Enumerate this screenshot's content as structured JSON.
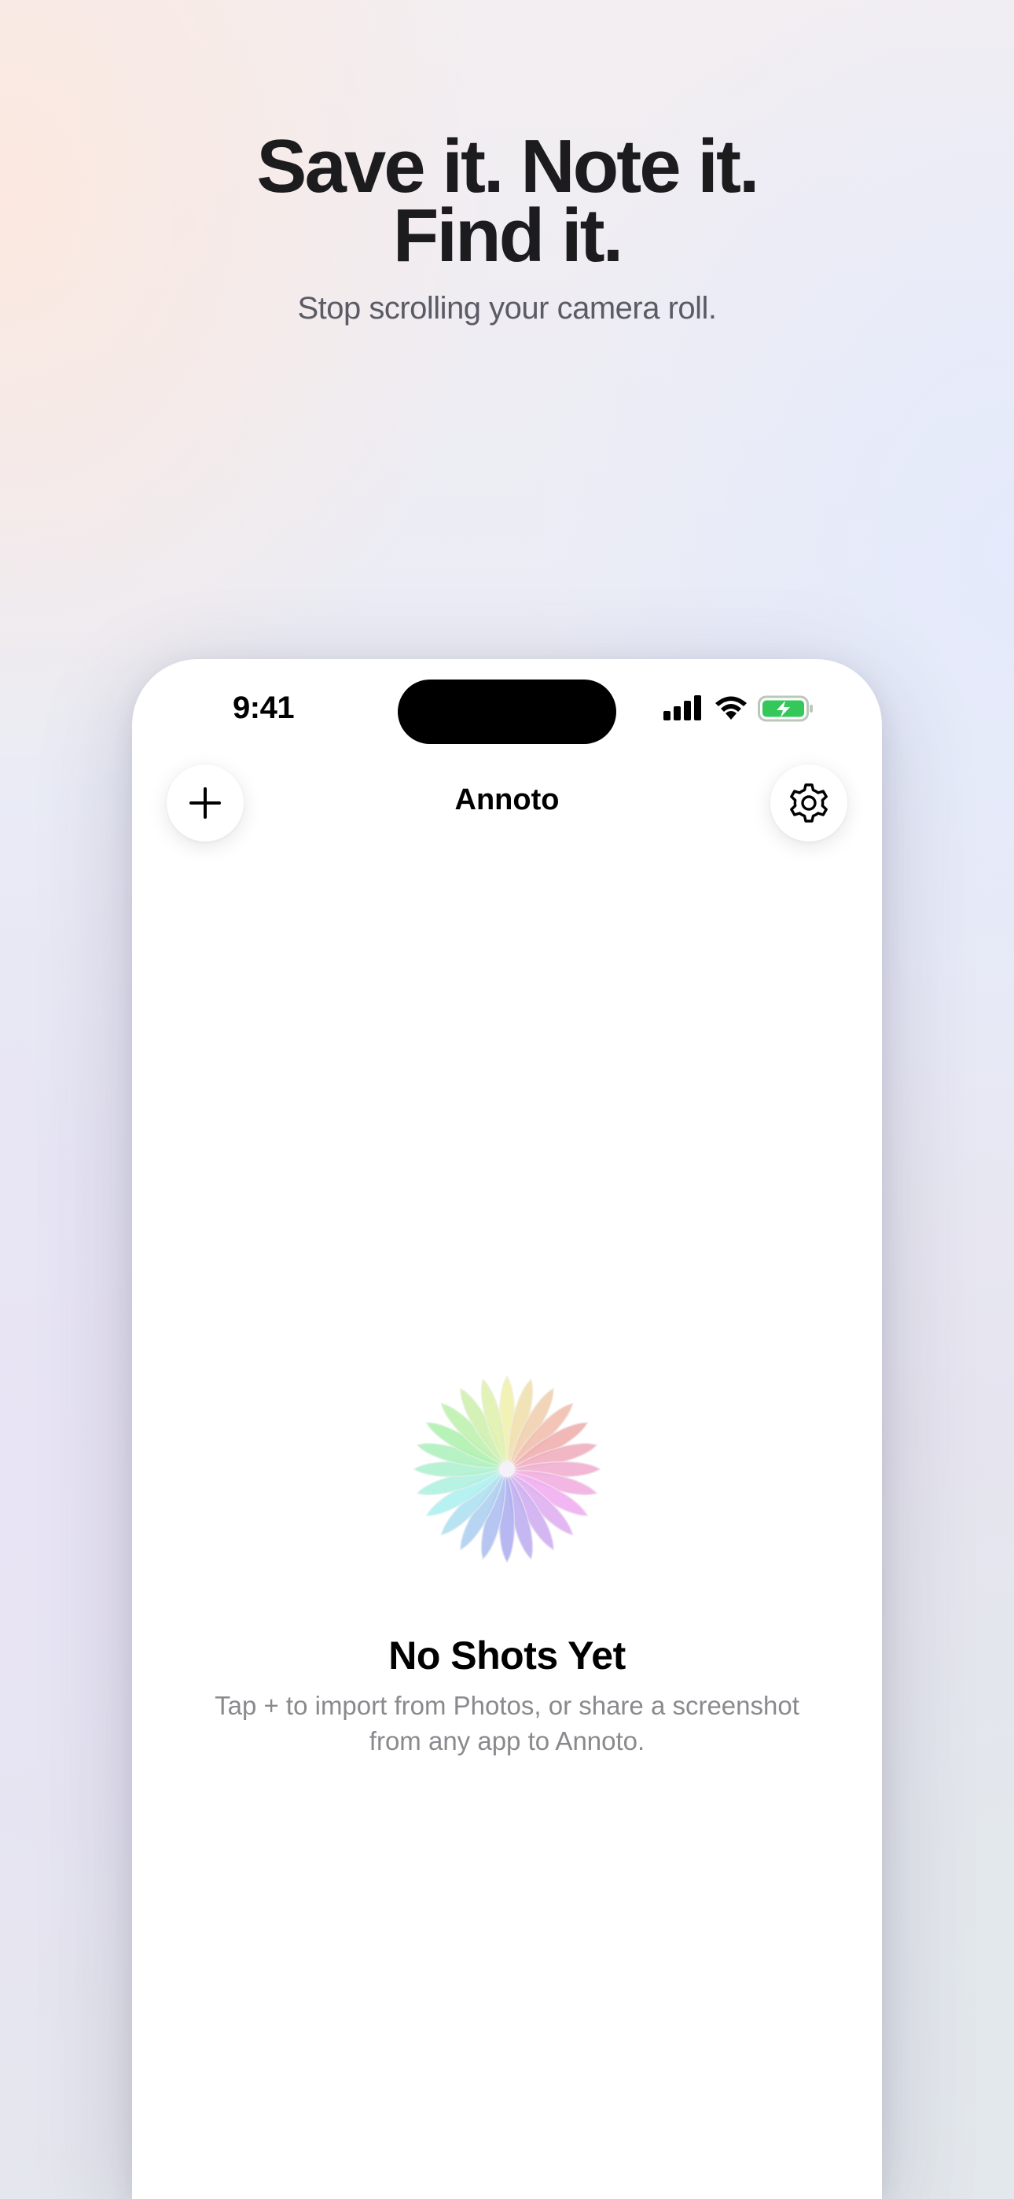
{
  "headline": {
    "line1": "Save it. Note it.",
    "line2": "Find it."
  },
  "subheadline": "Stop scrolling your camera roll.",
  "status_bar": {
    "time": "9:41",
    "icons": [
      "cellular-signal-icon",
      "wifi-icon",
      "battery-charging-icon"
    ],
    "battery_color": "#34c759"
  },
  "nav": {
    "title": "Annoto",
    "add_icon": "plus-icon",
    "settings_icon": "gear-icon"
  },
  "empty_state": {
    "icon": "photos-flower-icon",
    "title": "No Shots Yet",
    "message_line1": "Tap + to import from Photos, or share a screenshot",
    "message_line2": "from any app to Annoto."
  },
  "colors": {
    "text_primary": "#1c1c1e",
    "text_secondary": "#5b5b66",
    "text_muted": "#8a8a8e"
  }
}
